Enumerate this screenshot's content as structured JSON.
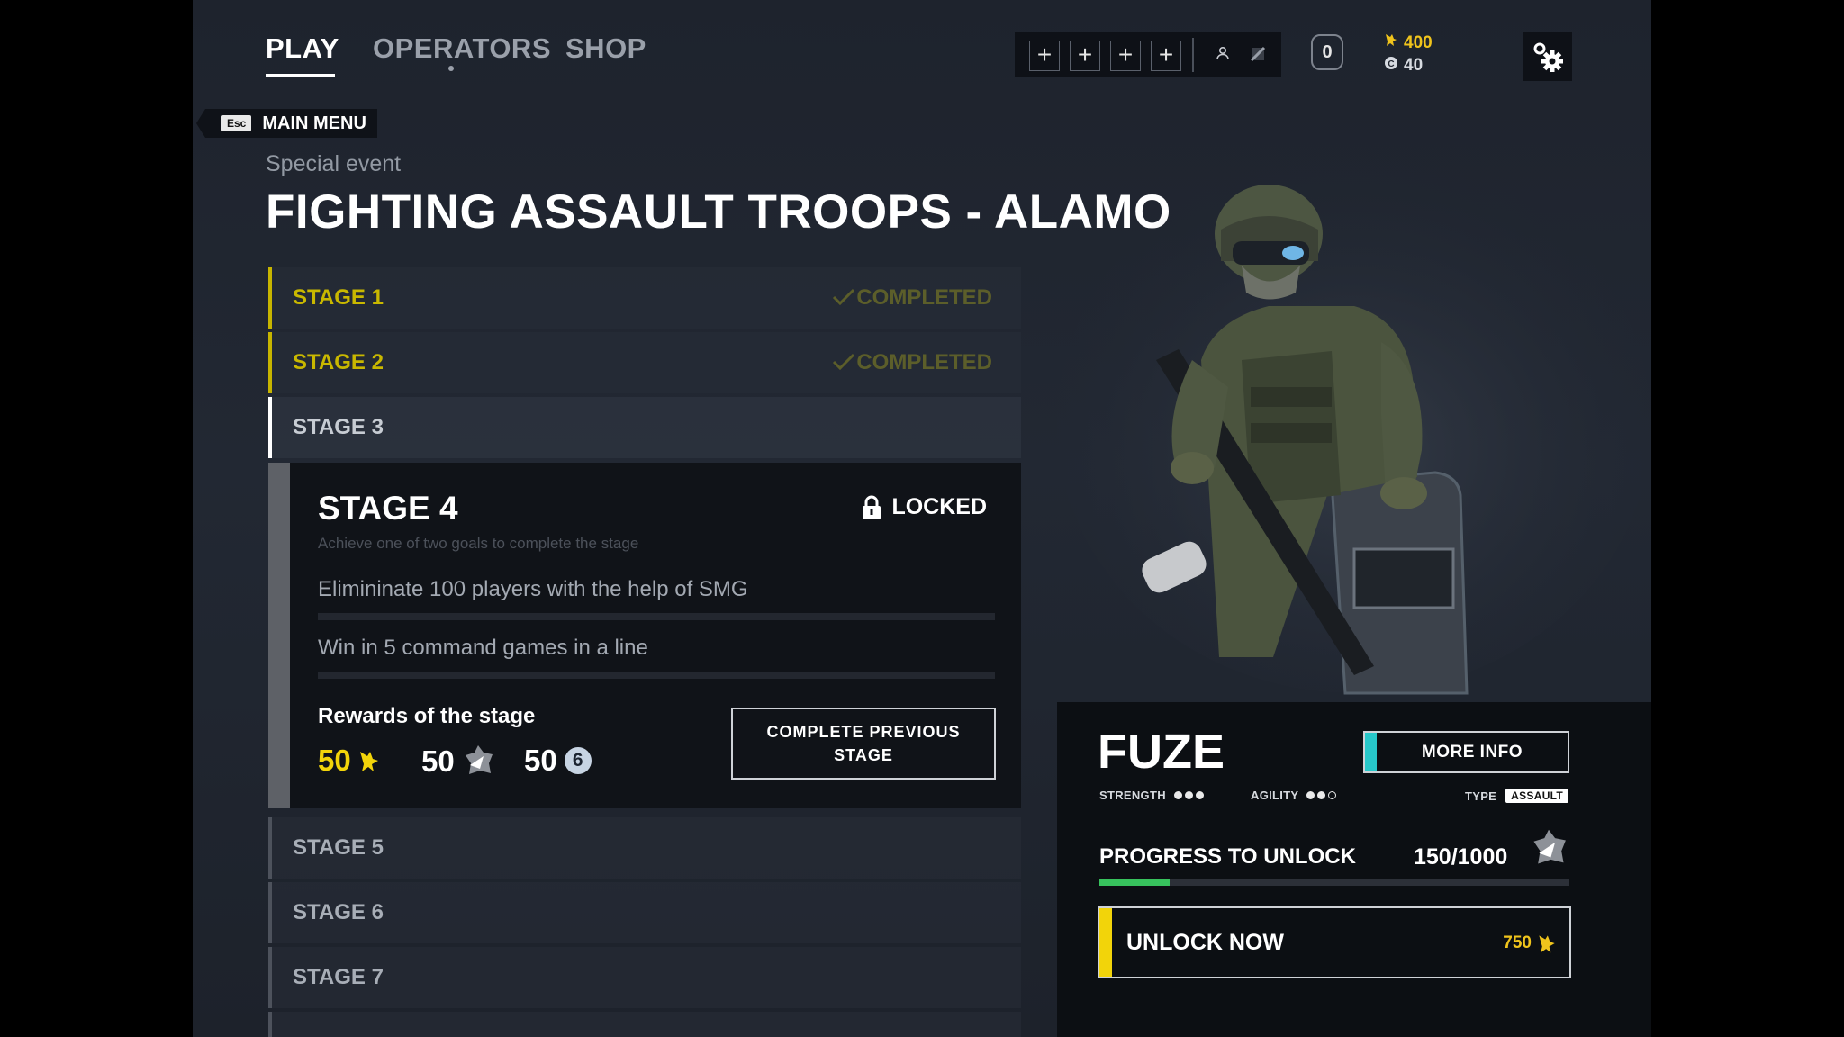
{
  "nav": {
    "tabs": [
      {
        "label": "PLAY",
        "active": true
      },
      {
        "label": "OPERATORS",
        "active": false
      },
      {
        "label": "SHOP",
        "active": false
      }
    ]
  },
  "top": {
    "squad_slots": [
      "+",
      "+",
      "+",
      "+"
    ],
    "squad_icons": [
      "person-icon",
      "flag-icon"
    ],
    "level": "0",
    "currencies": [
      {
        "icon": "gold-coin-icon",
        "value": "400",
        "color": "#f0c41c"
      },
      {
        "icon": "credit-icon",
        "value": "40",
        "color": "#d7dbe1"
      }
    ],
    "settings_icon": "gear-icon"
  },
  "back": {
    "key": "Esc",
    "label": "MAIN MENU"
  },
  "event": {
    "subtitle": "Special event",
    "title": "FIGHTING ASSAULT TROOPS - ALAMO"
  },
  "stages": [
    {
      "label": "STAGE 1",
      "status": "COMPLETED"
    },
    {
      "label": "STAGE 2",
      "status": "COMPLETED"
    },
    {
      "label": "STAGE 3",
      "status": ""
    },
    {
      "label": "STAGE 5",
      "status": ""
    },
    {
      "label": "STAGE 6",
      "status": ""
    },
    {
      "label": "STAGE 7",
      "status": ""
    }
  ],
  "stage4": {
    "title": "STAGE 4",
    "lock_label": "LOCKED",
    "hint": "Achieve one of two goals to complete the stage",
    "goals": [
      "Elimininate 100 players with the help of SMG",
      "Win in 5 command games in a line"
    ],
    "rewards_label": "Rewards of the stage",
    "rewards": [
      {
        "value": "50",
        "icon": "gold-coin-icon",
        "color": "#f2d40a"
      },
      {
        "value": "50",
        "icon": "operator-token-icon",
        "color": "#ffffff"
      },
      {
        "value": "50",
        "icon": "xp-badge-icon",
        "badge": "6",
        "color": "#ffffff"
      }
    ],
    "button_line1": "COMPLETE  PREVIOUS",
    "button_line2": "STAGE"
  },
  "operator": {
    "name": "FUZE",
    "more_info": "MORE INFO",
    "strength_label": "STRENGTH",
    "strength": 3,
    "agility_label": "AGILITY",
    "agility": 2,
    "type_label": "TYPE",
    "type": "ASSAULT",
    "progress_label": "PROGRESS TO UNLOCK",
    "progress_text": "150/1000",
    "progress_fraction": 0.15,
    "unlock_label": "UNLOCK NOW",
    "unlock_price": "750"
  }
}
